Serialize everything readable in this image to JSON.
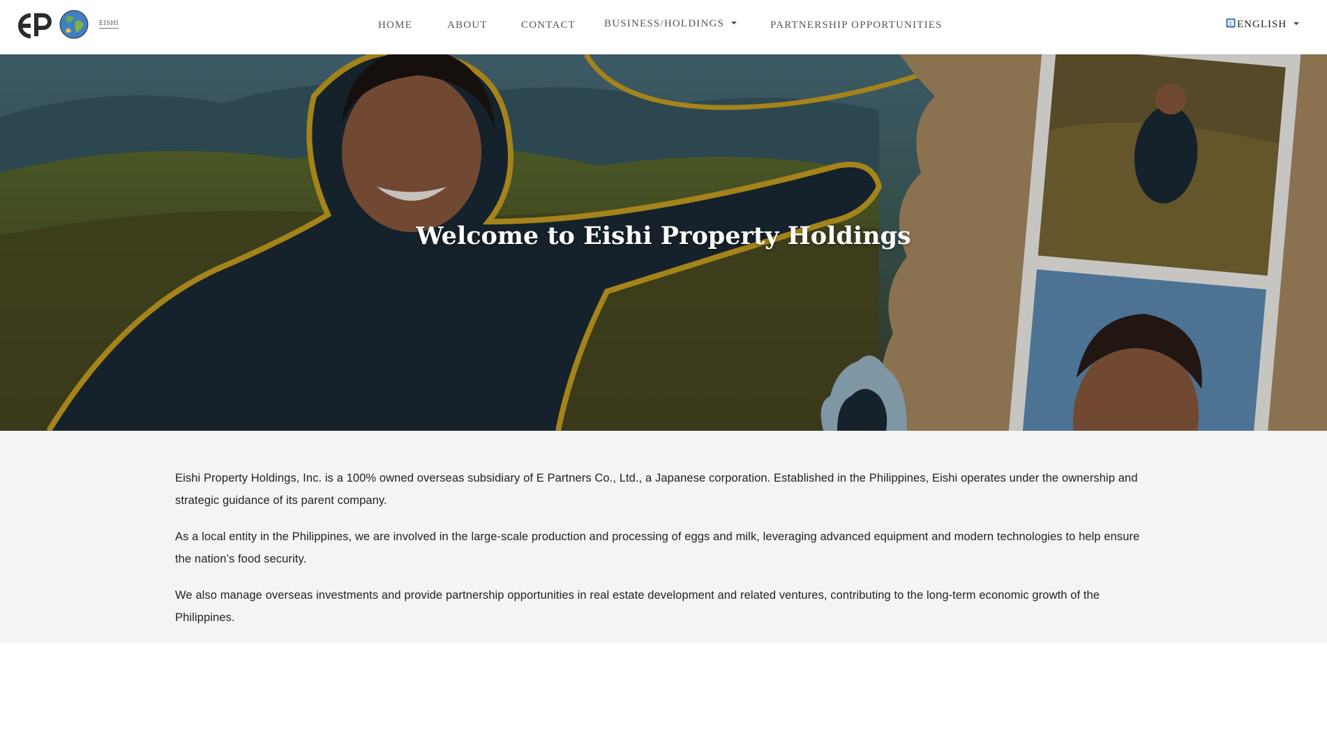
{
  "brand": {
    "logo_mark": "EP",
    "logo_subtext": "EISHI",
    "logo_icon": "globe-icon"
  },
  "nav": {
    "items": [
      {
        "label": "HOME"
      },
      {
        "label": "ABOUT"
      },
      {
        "label": "CONTACT"
      },
      {
        "label": "BUSINESS/HOLDINGS"
      },
      {
        "label": "PARTNERSHIP OPPORTUNITIES"
      }
    ],
    "language": "ENGLISH",
    "language_icon": "translate-icon"
  },
  "hero": {
    "title": "Welcome to Eishi Property Holdings"
  },
  "about": {
    "paragraphs": [
      "Eishi Property Holdings, Inc. is a 100% owned overseas subsidiary of E Partners Co., Ltd., a Japanese corporation. Established in the Philippines, Eishi operates under the ownership and strategic guidance of its parent company.",
      "As a local entity in the Philippines, we are involved in the large-scale production and processing of eggs and milk, leveraging advanced equipment and modern technologies to help ensure the nation’s food security.",
      "We also manage overseas investments and provide partnership opportunities in real estate development and related ventures, contributing to the long-term economic growth of the Philippines."
    ]
  },
  "colors": {
    "accent_outline": "#c9a020",
    "section_bg": "#f4f4f4",
    "text": "#222222",
    "nav_text": "#555555"
  }
}
